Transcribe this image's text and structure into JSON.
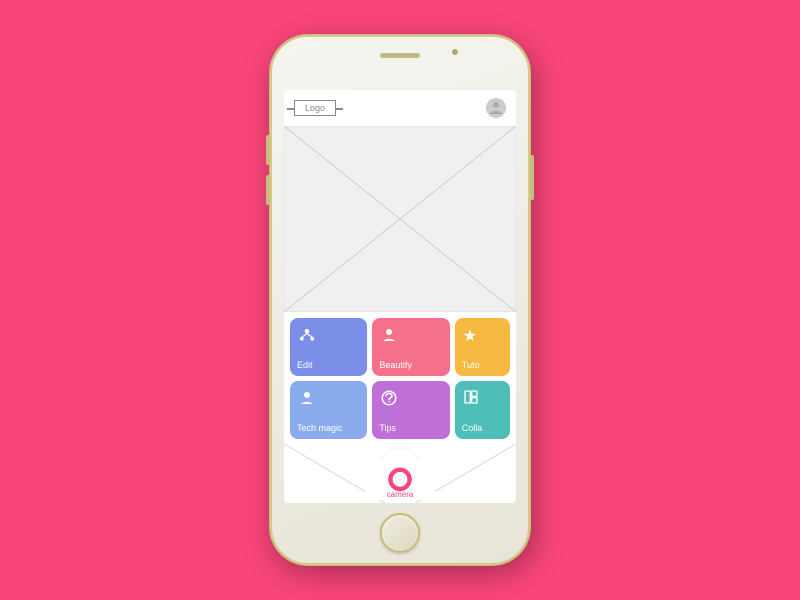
{
  "background_color": "#F9457A",
  "phone": {
    "logo_text": "Logo",
    "profile_icon": "👤",
    "tiles": [
      {
        "id": "edit",
        "label": "Edit",
        "icon": "⚙️",
        "color_class": "tile-edit",
        "unicode_icon": "❈"
      },
      {
        "id": "beautify",
        "label": "Beautify",
        "icon": "👤",
        "color_class": "tile-beautify",
        "unicode_icon": "👤"
      },
      {
        "id": "tutorial",
        "label": "Tuto",
        "icon": "★",
        "color_class": "tile-tutorial",
        "unicode_icon": "★"
      },
      {
        "id": "techmagic",
        "label": "Tech magic",
        "icon": "👤",
        "color_class": "tile-techmagic",
        "unicode_icon": "👤"
      },
      {
        "id": "tips",
        "label": "Tips",
        "icon": "🔧",
        "color_class": "tile-tips",
        "unicode_icon": "⚙"
      },
      {
        "id": "collage",
        "label": "Colla",
        "icon": "▦",
        "color_class": "tile-collage",
        "unicode_icon": "▦"
      }
    ],
    "camera_label": "camera"
  }
}
